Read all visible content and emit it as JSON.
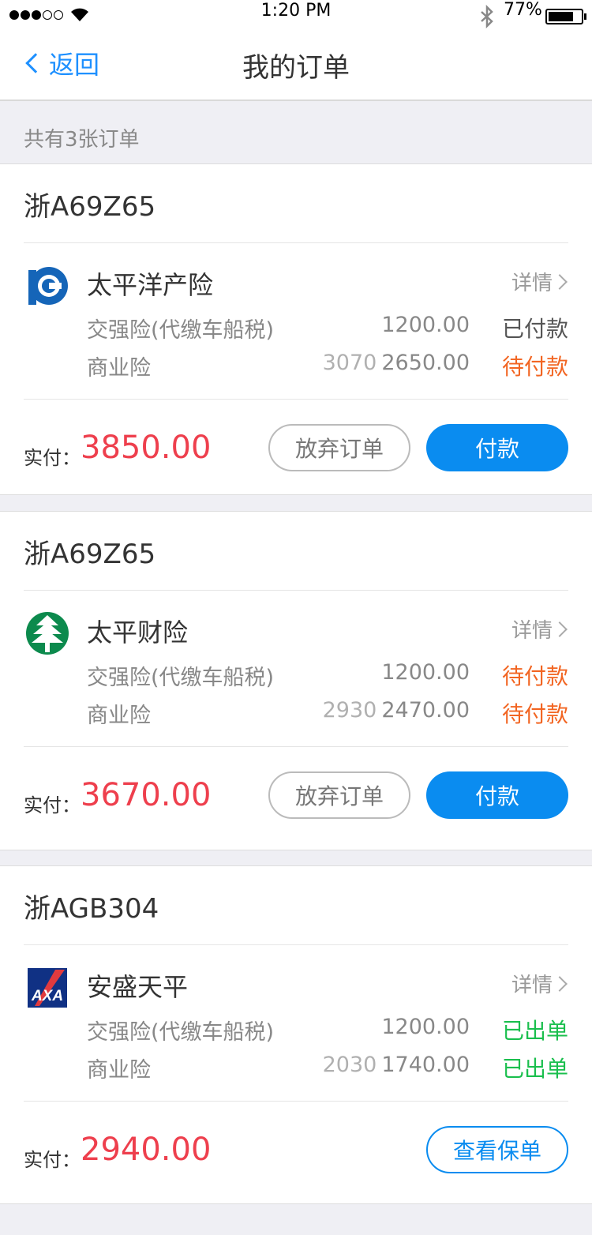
{
  "status_bar": {
    "time": "1:20 PM",
    "battery_pct": "77%",
    "battery_level": 0.77
  },
  "nav": {
    "back_label": "返回",
    "title": "我的订单"
  },
  "summary": "共有3张订单",
  "common": {
    "detail_label": "详情",
    "paid_label": "实付："
  },
  "orders": [
    {
      "plate": "浙A69Z65",
      "company": "太平洋产险",
      "logo": "cpic-logo",
      "items": [
        {
          "name": "交强险(代缴车船税)",
          "orig": "",
          "amount": "1200.00",
          "status": "已付款"
        },
        {
          "name": "商业险",
          "orig": "3070",
          "amount": "2650.00",
          "status": "待付款"
        }
      ],
      "paid_amount": "3850.00",
      "buttons": [
        "放弃订单",
        "付款"
      ]
    },
    {
      "plate": "浙A69Z65",
      "company": "太平财险",
      "logo": "taiping-tree-logo",
      "items": [
        {
          "name": "交强险(代缴车船税)",
          "orig": "",
          "amount": "1200.00",
          "status": "待付款"
        },
        {
          "name": "商业险",
          "orig": "2930",
          "amount": "2470.00",
          "status": "待付款"
        }
      ],
      "paid_amount": "3670.00",
      "buttons": [
        "放弃订单",
        "付款"
      ]
    },
    {
      "plate": "浙AGB304",
      "company": "安盛天平",
      "logo": "axa-logo",
      "items": [
        {
          "name": "交强险(代缴车船税)",
          "orig": "",
          "amount": "1200.00",
          "status": "已出单"
        },
        {
          "name": "商业险",
          "orig": "2030",
          "amount": "1740.00",
          "status": "已出单"
        }
      ],
      "paid_amount": "2940.00",
      "buttons": [
        "查看保单"
      ]
    }
  ],
  "colors": {
    "accent": "#0a8cf0",
    "price": "#ee3f4d",
    "pending": "#f26522",
    "issued": "#1bbf4e"
  }
}
